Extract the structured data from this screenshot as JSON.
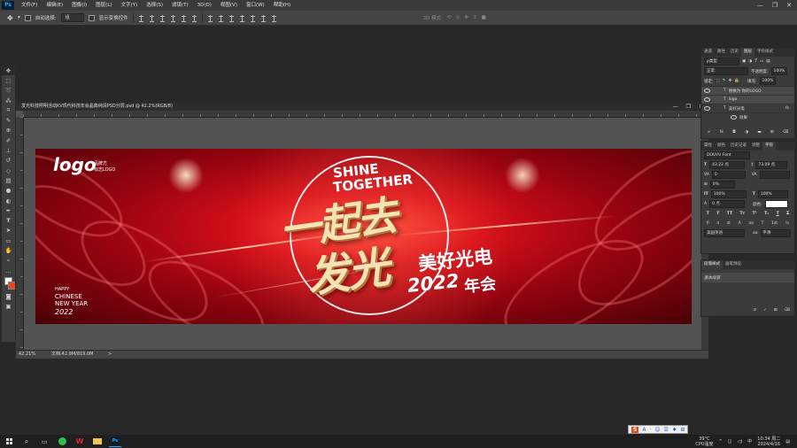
{
  "menubar": {
    "app_badge": "Ps",
    "items": [
      "文件(F)",
      "编辑(E)",
      "图像(I)",
      "图层(L)",
      "文字(Y)",
      "选择(S)",
      "滤镜(T)",
      "3D(D)",
      "视图(V)",
      "窗口(W)",
      "帮助(H)"
    ],
    "window_buttons": [
      "—",
      "❐",
      "✕"
    ]
  },
  "options": {
    "auto_select_label": "自动选择:",
    "auto_select_value": "组",
    "show_transform_label": "显示变换控件",
    "mode_3d_label": "3D 模式:"
  },
  "document": {
    "title": "发光科技照明活动KV现代科技年会晶典纯清PSD分层.psd @ 42.2%(RGB/8)",
    "zoom": "42.21%",
    "doc_size": "文档:42.9M/819.0M",
    "window_buttons": [
      "—",
      "❐",
      "✕"
    ]
  },
  "canvas": {
    "logo": "logo",
    "logo_sub1": "品牌方",
    "logo_sub2": "标志LOGO",
    "shine1": "SHINE",
    "shine2": "TOGETHER",
    "main1": "一起去",
    "main2": "发光",
    "brand": "美好光电",
    "year": "2022",
    "year_suffix": "年会",
    "happy": "HAPPY",
    "chinese": "CHINESE",
    "newyear": "NEW YEAR",
    "year_small": "2022"
  },
  "layers_panel": {
    "tabs": [
      "通道",
      "路径",
      "历史",
      "图层",
      "字符样式"
    ],
    "active_tab": "图层",
    "kind": "ρ类型",
    "blend_mode": "正常",
    "opacity_label": "不透明度:",
    "opacity": "100%",
    "lock_label": "锁定:",
    "fill_label": "填充:",
    "fill": "100%",
    "layers": [
      {
        "name": "替换为 你的LOGO",
        "fx": false
      },
      {
        "name": "logo",
        "fx": false
      },
      {
        "name": "美好光电",
        "fx": true
      },
      {
        "name": "效果",
        "fx": false
      }
    ]
  },
  "character_panel": {
    "tabs": [
      "属性",
      "颜色",
      "历史记录",
      "调整",
      "字符"
    ],
    "active_tab": "字符",
    "font": "DOUYU Font",
    "font_size": "43.22 点",
    "leading": "73.09 点",
    "tracking": "0",
    "kerning": "",
    "scale_label": "0%",
    "vscale": "100%",
    "hscale": "100%",
    "baseline": "0 点",
    "color_label": "颜色:",
    "language": "美国英语",
    "aa_label": "aa",
    "aa_value": "平滑"
  },
  "paragraph_styles_panel": {
    "tabs": [
      "段落样式",
      "画笔预设"
    ],
    "entry": "基本段落"
  },
  "taskbar": {
    "weather_temp": "39°C",
    "weather_desc": "CPU温度",
    "time": "10:34 周二",
    "date": "2024/4/16"
  },
  "ime": {
    "label": "S",
    "items": [
      "A",
      "·",
      "☺",
      "☰",
      "♦",
      "⊞"
    ]
  },
  "colors": {
    "accent": "#31a8ff",
    "banner_red": "#d7101a",
    "gold": "#f6e2b4"
  }
}
